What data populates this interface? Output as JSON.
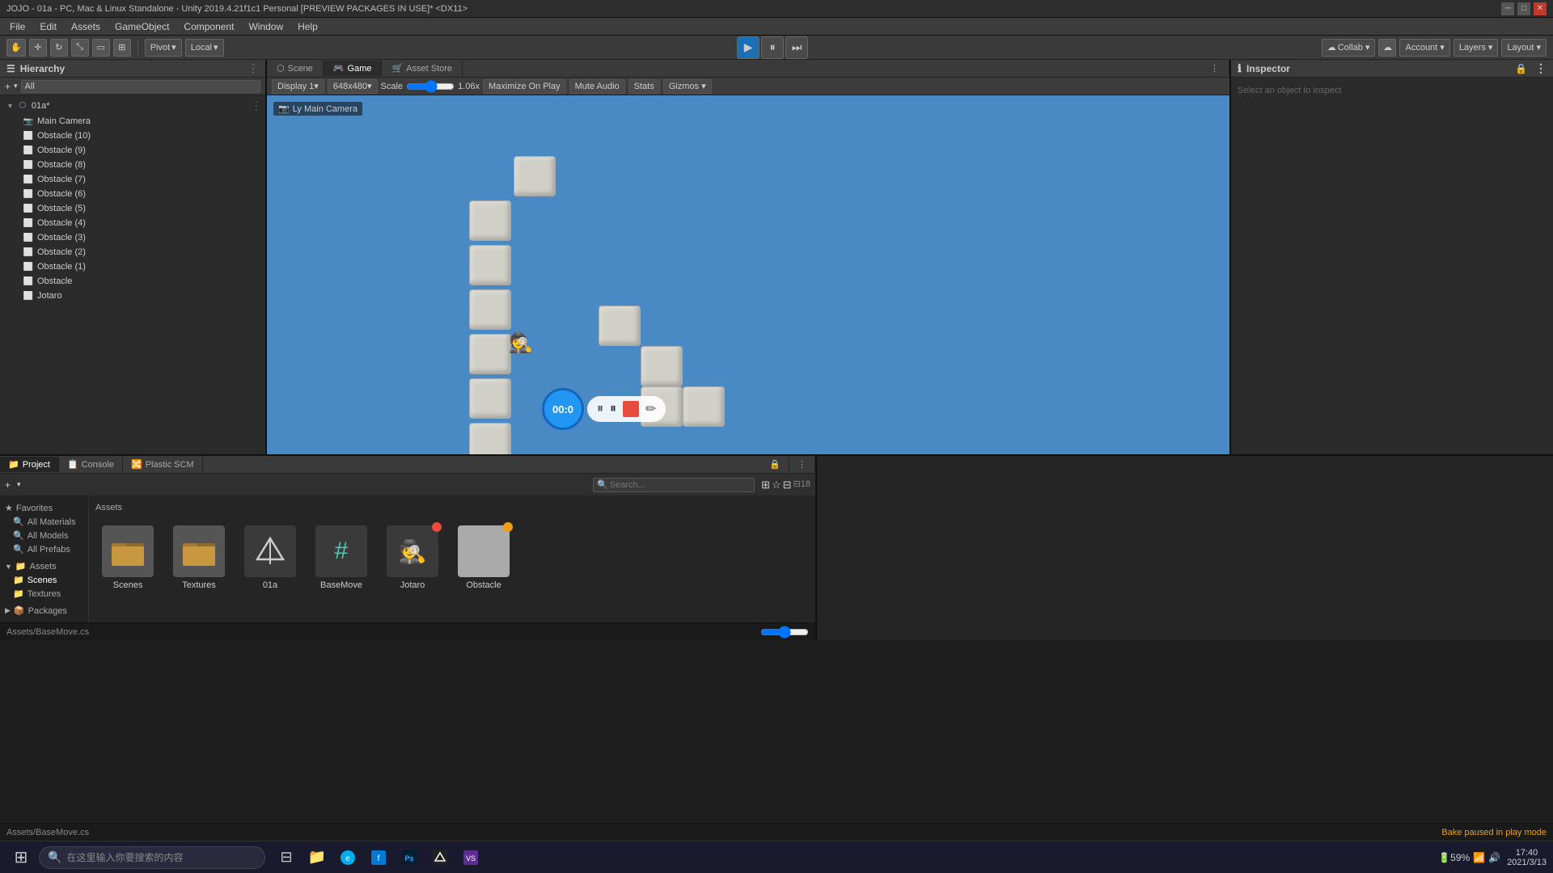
{
  "titlebar": {
    "title": "JOJO - 01a - PC, Mac & Linux Standalone - Unity 2019.4.21f1c1 Personal [PREVIEW PACKAGES IN USE]* <DX11>",
    "min": "─",
    "max": "□",
    "close": "✕"
  },
  "menubar": {
    "items": [
      "File",
      "Edit",
      "Assets",
      "GameObject",
      "Component",
      "Window",
      "Help"
    ]
  },
  "toolbar": {
    "pivot_label": "Pivot",
    "local_label": "Local",
    "collab_label": "Collab ▾",
    "account_label": "Account ▾",
    "layers_label": "Layers ▾",
    "layout_label": "Layout ▾"
  },
  "hierarchy": {
    "panel_label": "Hierarchy",
    "search_placeholder": "All",
    "items": [
      {
        "label": "01a*",
        "level": 0,
        "has_children": true,
        "icon": "scene"
      },
      {
        "label": "Main Camera",
        "level": 1,
        "icon": "camera"
      },
      {
        "label": "Obstacle (10)",
        "level": 1,
        "icon": "cube"
      },
      {
        "label": "Obstacle (9)",
        "level": 1,
        "icon": "cube"
      },
      {
        "label": "Obstacle (8)",
        "level": 1,
        "icon": "cube"
      },
      {
        "label": "Obstacle (7)",
        "level": 1,
        "icon": "cube"
      },
      {
        "label": "Obstacle (6)",
        "level": 1,
        "icon": "cube"
      },
      {
        "label": "Obstacle (5)",
        "level": 1,
        "icon": "cube"
      },
      {
        "label": "Obstacle (4)",
        "level": 1,
        "icon": "cube"
      },
      {
        "label": "Obstacle (3)",
        "level": 1,
        "icon": "cube"
      },
      {
        "label": "Obstacle (2)",
        "level": 1,
        "icon": "cube"
      },
      {
        "label": "Obstacle (1)",
        "level": 1,
        "icon": "cube"
      },
      {
        "label": "Obstacle",
        "level": 1,
        "icon": "cube"
      },
      {
        "label": "Jotaro",
        "level": 1,
        "icon": "cube"
      }
    ]
  },
  "view_tabs": {
    "scene": "Scene",
    "game": "Game",
    "asset_store": "Asset Store"
  },
  "game_toolbar": {
    "display": "Display 1",
    "resolution": "648x480",
    "scale_label": "Scale",
    "scale_value": "1.06x",
    "maximize": "Maximize On Play",
    "mute": "Mute Audio",
    "stats": "Stats",
    "gizmos": "Gizmos ▾"
  },
  "main_camera_label": "Ly Main Camera",
  "timer": {
    "time": "00:0",
    "pause_icon": "⏸",
    "stop_icon": "■",
    "pen_icon": "✏"
  },
  "inspector": {
    "tab_label": "Inspector",
    "lock_icon": "🔒",
    "menu_icon": "⋮"
  },
  "bottom_tabs": {
    "project": "Project",
    "console": "Console",
    "plastic_scm": "Plastic SCM"
  },
  "project_sidebar": {
    "favorites_label": "Favorites",
    "favorites_items": [
      "All Materials",
      "All Models",
      "All Prefabs"
    ],
    "assets_label": "Assets",
    "assets_items": [
      "Scenes",
      "Textures"
    ],
    "packages_label": "Packages"
  },
  "assets_header": "Assets",
  "project_assets": [
    {
      "label": "Scenes",
      "icon": "folder",
      "badge": null
    },
    {
      "label": "Textures",
      "icon": "folder",
      "badge": null
    },
    {
      "label": "01a",
      "icon": "unity",
      "badge": null
    },
    {
      "label": "BaseMove",
      "icon": "script_hash",
      "badge": null
    },
    {
      "label": "Jotaro",
      "icon": "character",
      "badge": "red"
    },
    {
      "label": "Obstacle",
      "icon": "cube_asset",
      "badge": "yellow"
    }
  ],
  "status_bar": {
    "left": "Assets/BaseMove.cs",
    "right": "Bake paused in play mode"
  },
  "taskbar": {
    "search_placeholder": "在这里输入你要搜索的内容",
    "time": "17:40",
    "date": "2021/3/13"
  }
}
